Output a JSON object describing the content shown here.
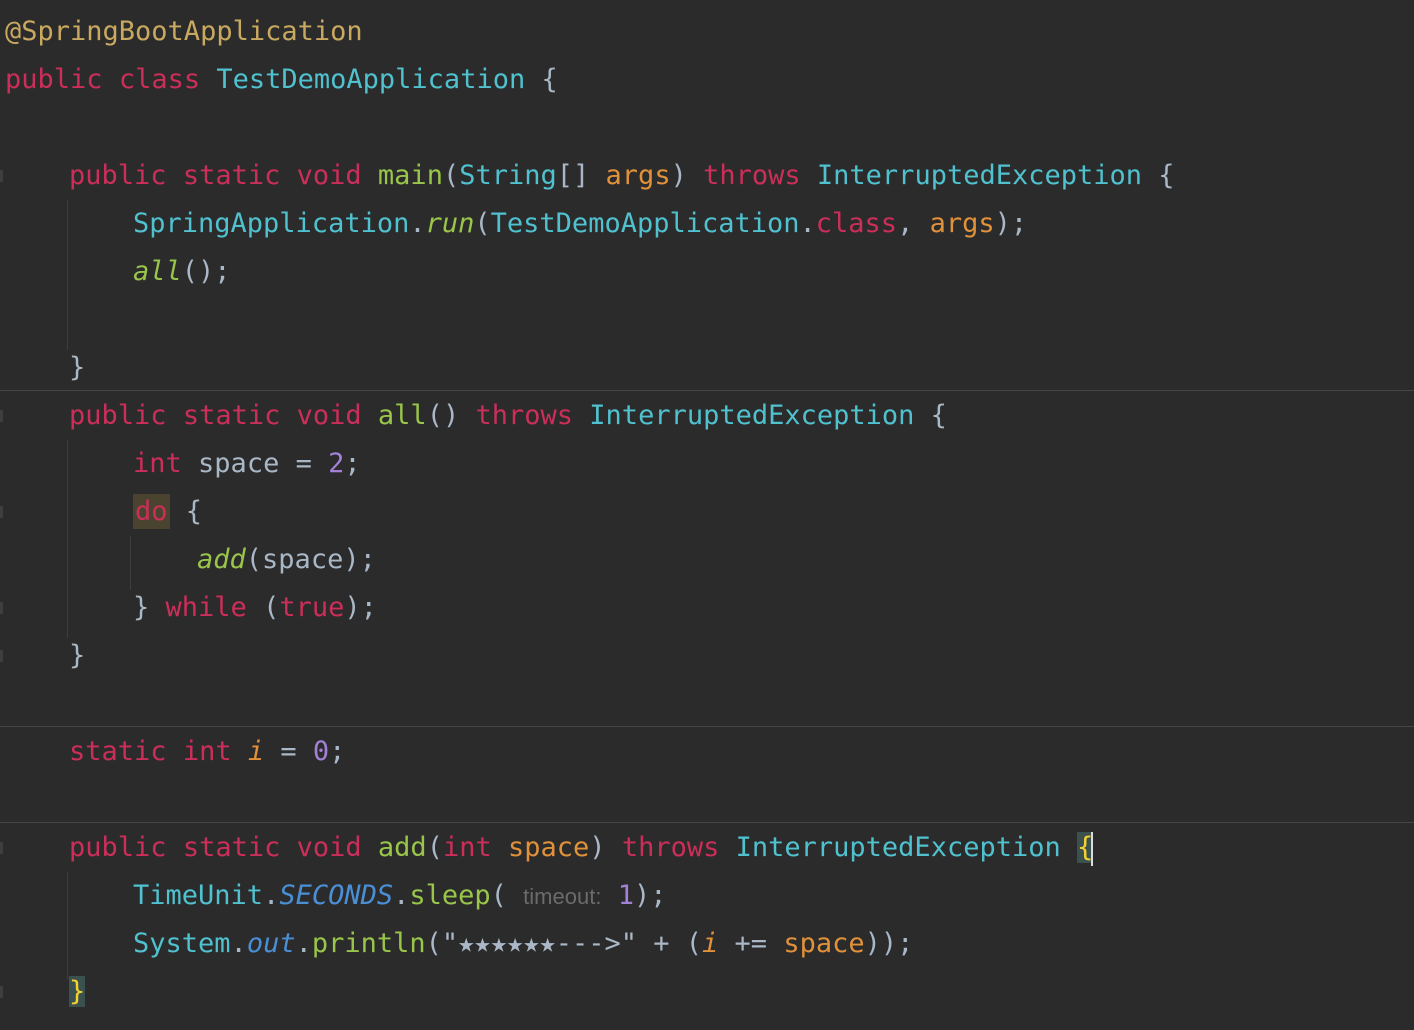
{
  "code": {
    "annotation": "@SpringBootApplication",
    "kw_public": "public",
    "kw_class": "class",
    "kw_static": "static",
    "kw_void": "void",
    "kw_throws": "throws",
    "kw_int": "int",
    "kw_do": "do",
    "kw_while": "while",
    "kw_true": "true",
    "class_name": "TestDemoApplication",
    "type_string": "String",
    "type_exception": "InterruptedException",
    "type_spring_app": "SpringApplication",
    "type_timeunit": "TimeUnit",
    "type_system": "System",
    "fn_main": "main",
    "fn_run": "run",
    "fn_all": "all",
    "fn_add": "add",
    "fn_sleep": "sleep",
    "fn_println": "println",
    "var_args": "args",
    "var_space": "space",
    "var_i": "i",
    "const_seconds": "SECONDS",
    "field_out": "out",
    "num_two": "2",
    "num_zero": "0",
    "num_one": "1",
    "hint_timeout": "timeout:",
    "string_literal": "\"★★★★★★--->\"",
    "brace_open": "{",
    "brace_close": "}"
  }
}
